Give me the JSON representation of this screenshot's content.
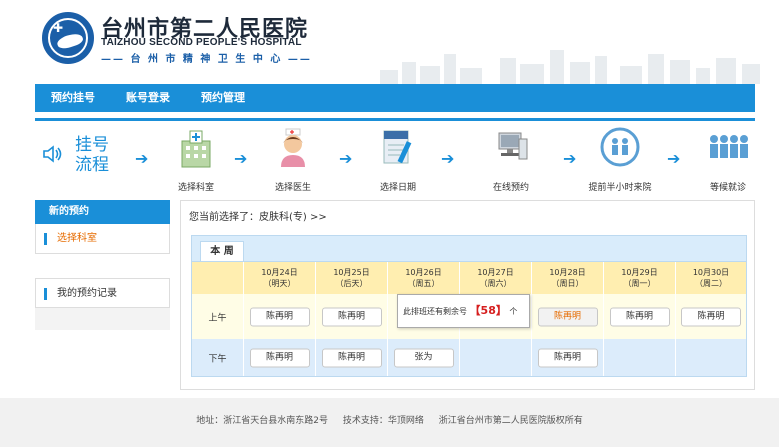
{
  "header": {
    "name_cn": "台州市第二人民医院",
    "name_en": "TAIZHOU SECOND PEOPLE'S HOSPITAL",
    "subtitle": "—— 台 州 市 精 神 卫 生 中 心 ——"
  },
  "nav": {
    "items": [
      {
        "label": "预约挂号"
      },
      {
        "label": "账号登录"
      },
      {
        "label": "预约管理"
      }
    ]
  },
  "process": {
    "title_line1": "挂号",
    "title_line2": "流程",
    "steps": [
      {
        "label": "选择科室",
        "icon": "hospital-building-icon"
      },
      {
        "label": "选择医生",
        "icon": "nurse-icon"
      },
      {
        "label": "选择日期",
        "icon": "calendar-pen-icon"
      },
      {
        "label": "在线预约",
        "icon": "computer-icon"
      },
      {
        "label": "提前半小时来院",
        "icon": "people-circle-icon"
      },
      {
        "label": "等候就诊",
        "icon": "waiting-people-icon"
      }
    ]
  },
  "sidebar": {
    "header": "新的预约",
    "items": [
      {
        "label": "选择科室",
        "active": true
      },
      {
        "label": "我的预约记录",
        "active": false
      }
    ]
  },
  "main": {
    "breadcrumb": "您当前选择了：皮肤科(专) >>",
    "tab": "本 周",
    "days": [
      {
        "date": "10月24日",
        "weekday": "（明天）"
      },
      {
        "date": "10月25日",
        "weekday": "（后天）"
      },
      {
        "date": "10月26日",
        "weekday": "（周五）"
      },
      {
        "date": "10月27日",
        "weekday": "（周六）"
      },
      {
        "date": "10月28日",
        "weekday": "（周日）"
      },
      {
        "date": "10月29日",
        "weekday": "（周一）"
      },
      {
        "date": "10月30日",
        "weekday": "（周二）"
      }
    ],
    "am_label": "上午",
    "pm_label": "下午",
    "am_slots": [
      "陈再明",
      "陈再明",
      "",
      "",
      "陈再明",
      "陈再明",
      "陈再明"
    ],
    "pm_slots": [
      "陈再明",
      "陈再明",
      "张为",
      "",
      "陈再明",
      "",
      ""
    ]
  },
  "tooltip": {
    "prefix": "此排班还有剩余号",
    "count": "【58】",
    "suffix": "个"
  },
  "footer": {
    "address": "地址：浙江省天台县水南东路2号",
    "support": "技术支持：华顶网络",
    "copyright": "浙江省台州市第二人民医院版权所有"
  },
  "colors": {
    "primary": "#1a8fd8",
    "accent": "#e66b00",
    "header_row": "#ffeeb0",
    "am_row": "#fffde6",
    "pm_row": "#dcecfb"
  }
}
